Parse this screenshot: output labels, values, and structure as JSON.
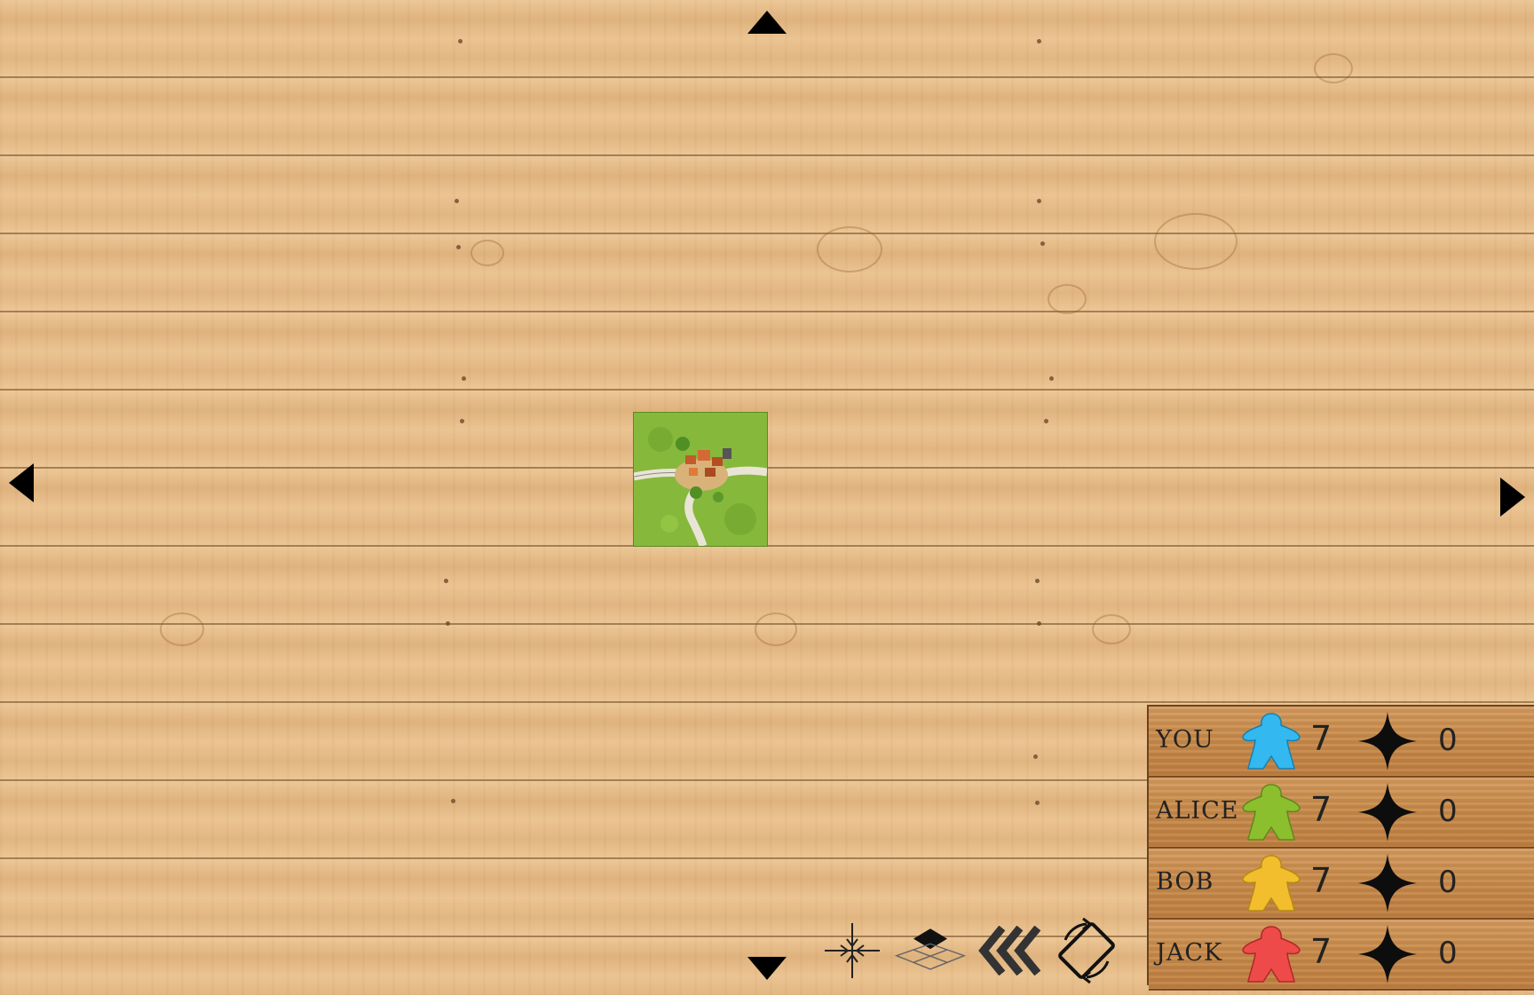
{
  "board": {
    "texture": "wood-planks",
    "tile": {
      "name": "starting-tile",
      "features": [
        "city",
        "road",
        "field"
      ]
    }
  },
  "navigation": {
    "up_icon": "arrow-up-icon",
    "down_icon": "arrow-down-icon",
    "left_icon": "arrow-left-icon",
    "right_icon": "arrow-right-icon"
  },
  "toolbar": {
    "tools": [
      {
        "id": "center",
        "icon": "center-view-icon"
      },
      {
        "id": "layers",
        "icon": "layers-icon"
      },
      {
        "id": "undo",
        "icon": "rewind-icon"
      },
      {
        "id": "rotate",
        "icon": "rotate-tile-icon"
      }
    ]
  },
  "players": [
    {
      "name": "YOU",
      "color": "#33b8f0",
      "meeples": "7",
      "score": "0"
    },
    {
      "name": "ALICE",
      "color": "#8cbf2e",
      "meeples": "7",
      "score": "0"
    },
    {
      "name": "BOB",
      "color": "#f2be2e",
      "meeples": "7",
      "score": "0"
    },
    {
      "name": "JACK",
      "color": "#ef4a4a",
      "meeples": "7",
      "score": "0"
    }
  ]
}
